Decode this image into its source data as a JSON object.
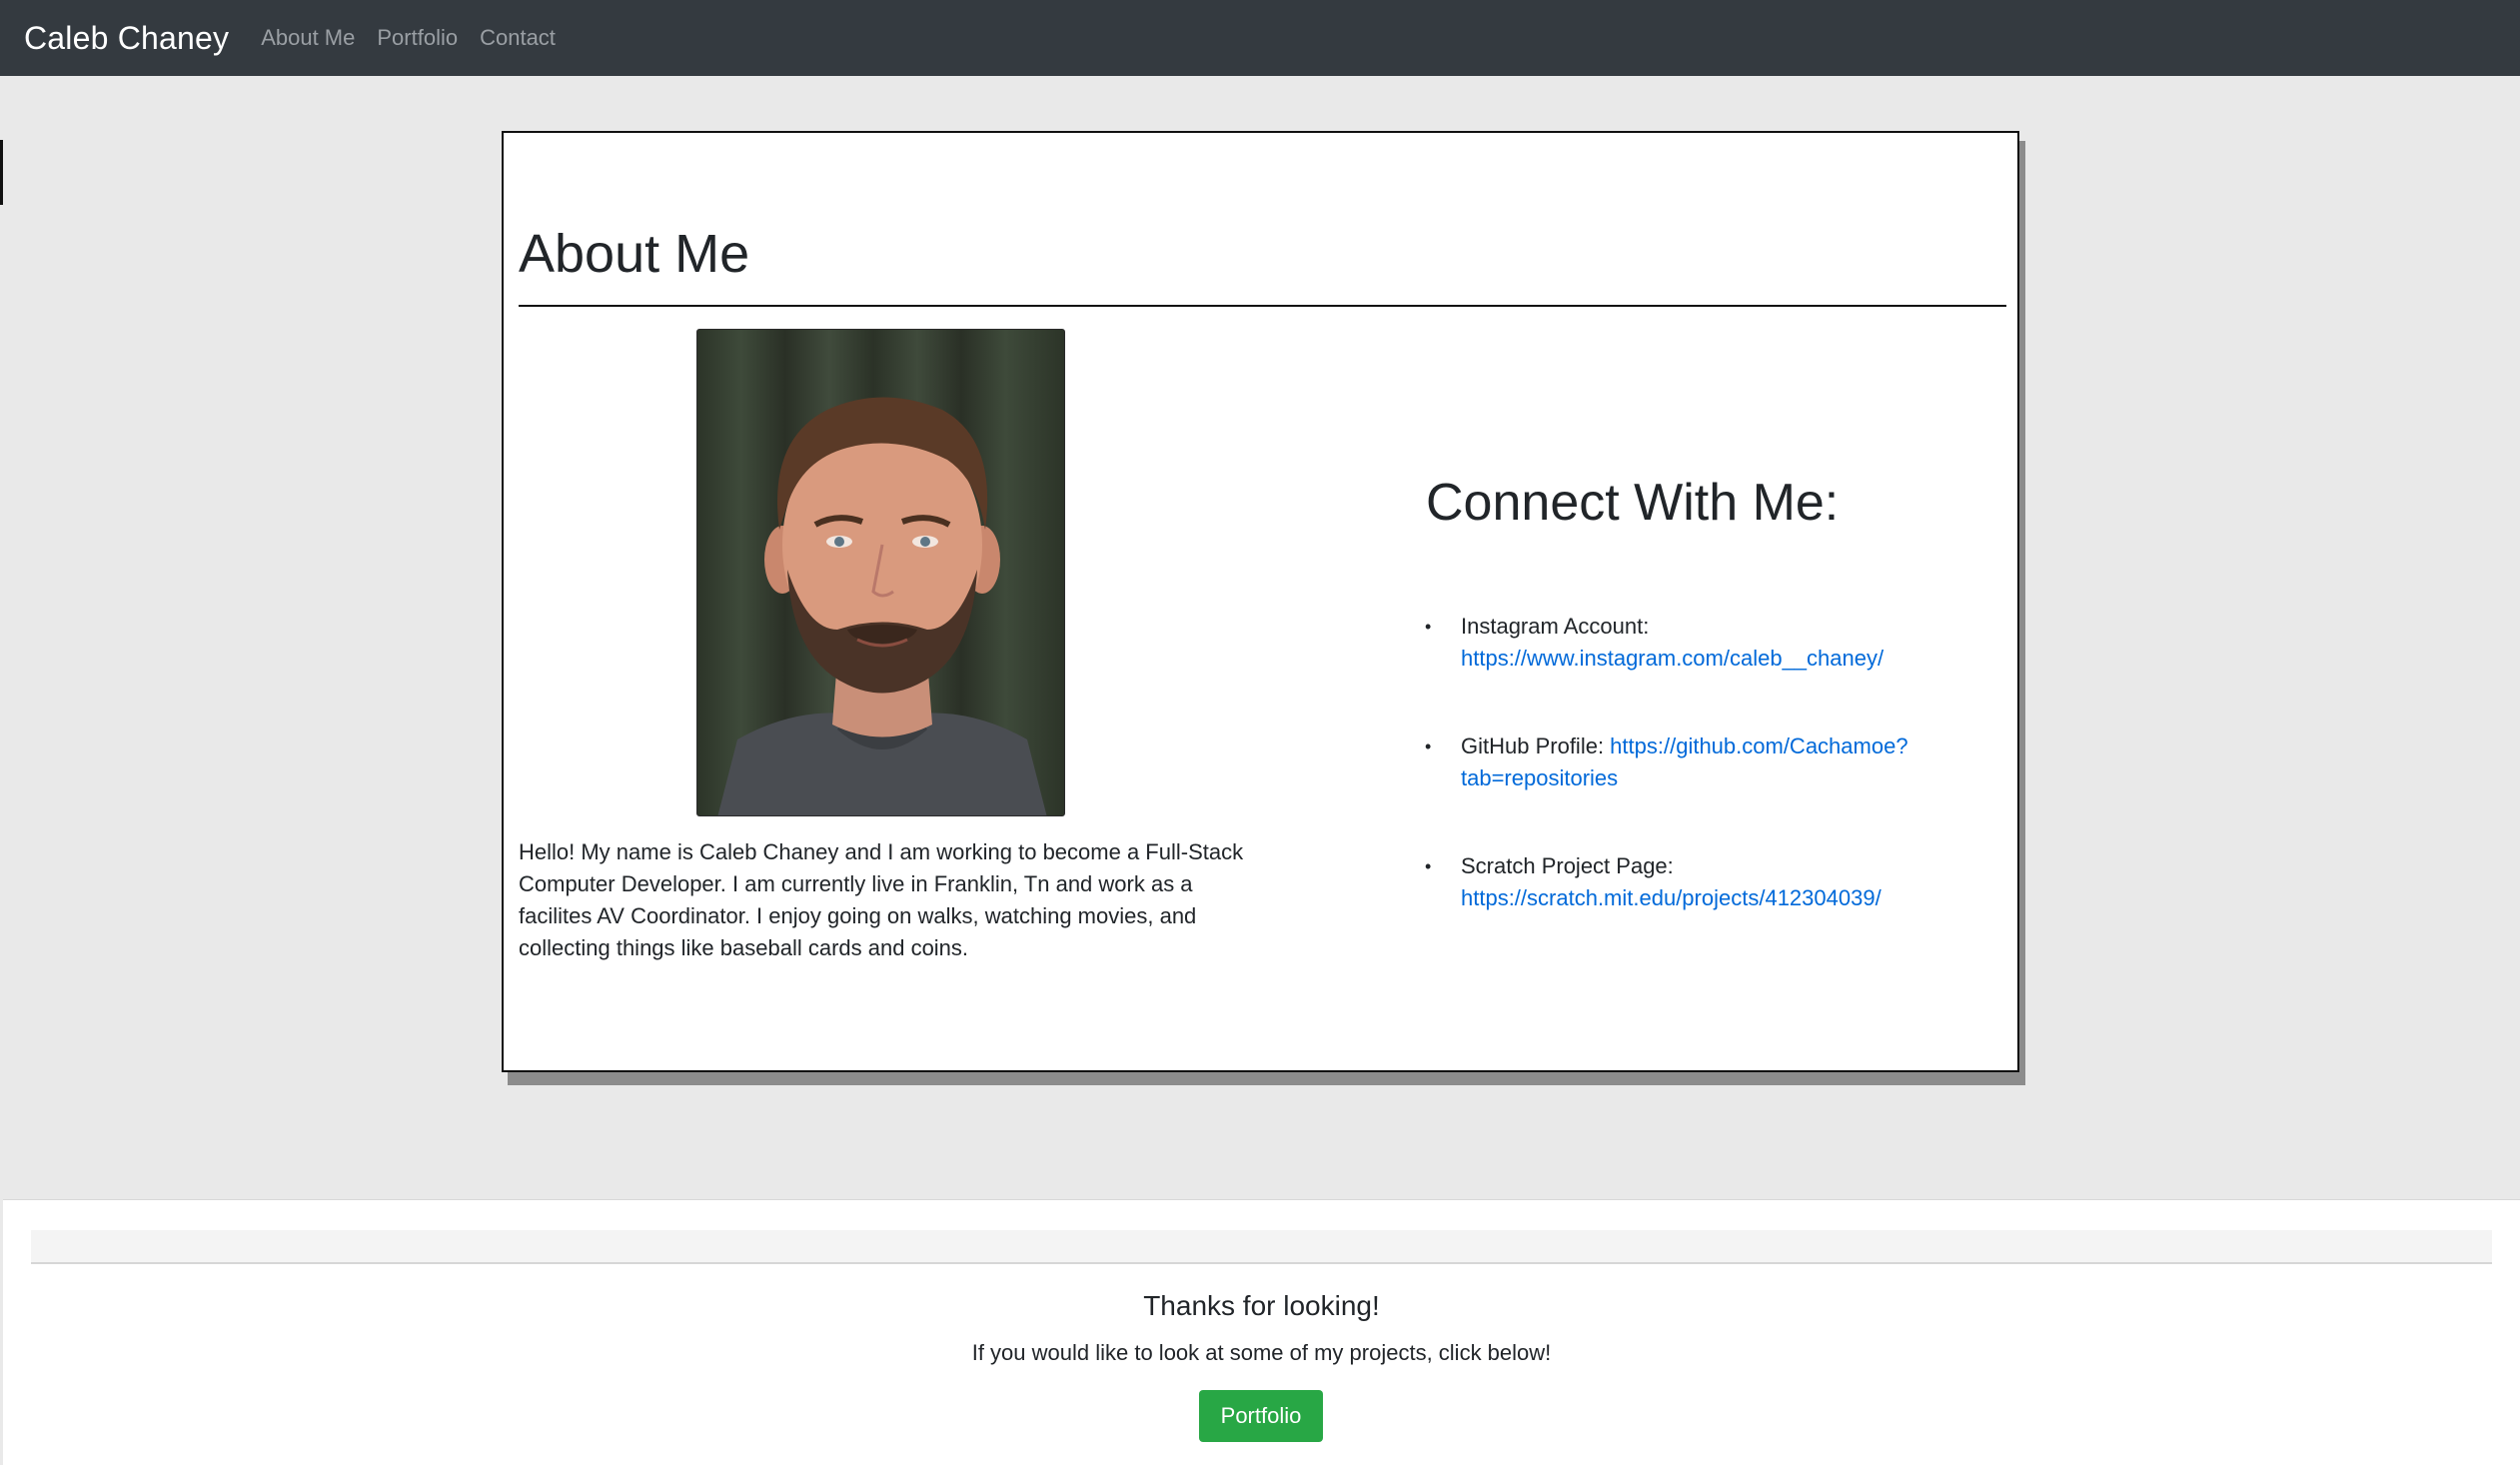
{
  "navbar": {
    "brand": "Caleb Chaney",
    "links": [
      "About Me",
      "Portfolio",
      "Contact"
    ]
  },
  "about": {
    "title": "About Me",
    "photo_alt": "portrait-photo",
    "bio": "Hello! My name is Caleb Chaney and I am working to become a Full-Stack Computer Developer. I am currently live in Franklin, Tn and work as a facilites AV Coordinator. I enjoy going on walks, watching movies, and collecting things like baseball cards and coins."
  },
  "connect": {
    "title": "Connect With Me:",
    "items": [
      {
        "label": "Instagram Account:",
        "url": "https://www.instagram.com/caleb__chaney/"
      },
      {
        "label": "GitHub Profile:",
        "url": "https://github.com/Cachamoe?tab=repositories"
      },
      {
        "label": "Scratch Project Page:",
        "url": "https://scratch.mit.edu/projects/412304039/"
      }
    ]
  },
  "footer": {
    "thanks": "Thanks for looking!",
    "message": "If you would like to look at some of my projects, click below!",
    "button_label": "Portfolio"
  },
  "colors": {
    "navbar": "#343a40",
    "link": "#0069d9",
    "button": "#28a745",
    "page_bg": "#e9e9e9"
  }
}
